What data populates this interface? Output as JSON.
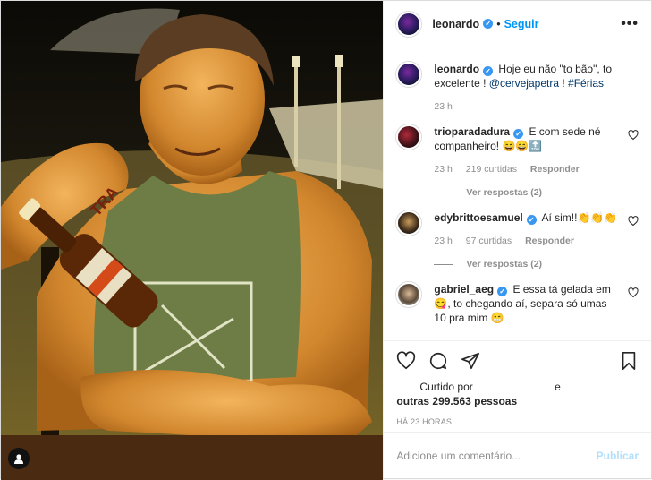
{
  "post": {
    "author": "leonardo",
    "follow_label": "Seguir",
    "more_label": "•••",
    "caption_text": "Hoje eu não \"to bão\", to excelente ! ",
    "caption_mention": "@cervejapetra",
    "caption_end": " ! ",
    "caption_hashtag": "#Férias",
    "caption_time": "23 h"
  },
  "comments": [
    {
      "user": "trioparadadura",
      "text": "E com sede né companheiro! 😄😄🔝",
      "time": "23 h",
      "likes": "219 curtidas",
      "reply_label": "Responder",
      "view_replies": "Ver respostas (2)"
    },
    {
      "user": "edybrittoesamuel",
      "text": "Aí sim!!👏👏👏",
      "time": "23 h",
      "likes": "97 curtidas",
      "reply_label": "Responder",
      "view_replies": "Ver respostas (2)"
    },
    {
      "user": "gabriel_aeg",
      "text": "E essa tá gelada em 😋, to chegando aí, separa só umas 10 pra mim 😁"
    }
  ],
  "likes": {
    "liked_by_label": "Curtido por",
    "and_label": "e",
    "others": "outras 299.563 pessoas"
  },
  "timestamp": "HÁ 23 HORAS",
  "add_comment": {
    "placeholder": "Adicione um comentário...",
    "publish_label": "Publicar"
  },
  "photo": {
    "label_on_bottle": "TRA"
  },
  "colors": {
    "link": "#0095f6",
    "verified": "#3897f0",
    "secondary_text": "#8e8e8e",
    "publish_disabled": "#b2dffc"
  }
}
